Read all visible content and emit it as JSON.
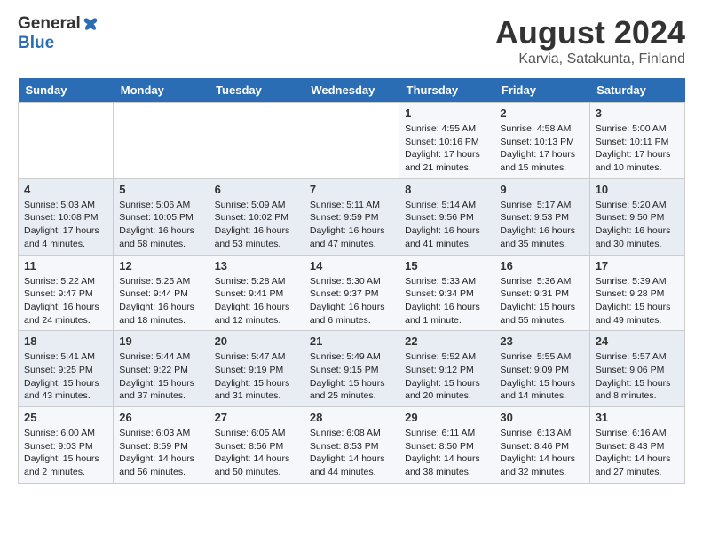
{
  "header": {
    "logo_general": "General",
    "logo_blue": "Blue",
    "month_title": "August 2024",
    "location": "Karvia, Satakunta, Finland"
  },
  "days_of_week": [
    "Sunday",
    "Monday",
    "Tuesday",
    "Wednesday",
    "Thursday",
    "Friday",
    "Saturday"
  ],
  "weeks": [
    [
      {
        "day": "",
        "content": ""
      },
      {
        "day": "",
        "content": ""
      },
      {
        "day": "",
        "content": ""
      },
      {
        "day": "",
        "content": ""
      },
      {
        "day": "1",
        "content": "Sunrise: 4:55 AM\nSunset: 10:16 PM\nDaylight: 17 hours\nand 21 minutes."
      },
      {
        "day": "2",
        "content": "Sunrise: 4:58 AM\nSunset: 10:13 PM\nDaylight: 17 hours\nand 15 minutes."
      },
      {
        "day": "3",
        "content": "Sunrise: 5:00 AM\nSunset: 10:11 PM\nDaylight: 17 hours\nand 10 minutes."
      }
    ],
    [
      {
        "day": "4",
        "content": "Sunrise: 5:03 AM\nSunset: 10:08 PM\nDaylight: 17 hours\nand 4 minutes."
      },
      {
        "day": "5",
        "content": "Sunrise: 5:06 AM\nSunset: 10:05 PM\nDaylight: 16 hours\nand 58 minutes."
      },
      {
        "day": "6",
        "content": "Sunrise: 5:09 AM\nSunset: 10:02 PM\nDaylight: 16 hours\nand 53 minutes."
      },
      {
        "day": "7",
        "content": "Sunrise: 5:11 AM\nSunset: 9:59 PM\nDaylight: 16 hours\nand 47 minutes."
      },
      {
        "day": "8",
        "content": "Sunrise: 5:14 AM\nSunset: 9:56 PM\nDaylight: 16 hours\nand 41 minutes."
      },
      {
        "day": "9",
        "content": "Sunrise: 5:17 AM\nSunset: 9:53 PM\nDaylight: 16 hours\nand 35 minutes."
      },
      {
        "day": "10",
        "content": "Sunrise: 5:20 AM\nSunset: 9:50 PM\nDaylight: 16 hours\nand 30 minutes."
      }
    ],
    [
      {
        "day": "11",
        "content": "Sunrise: 5:22 AM\nSunset: 9:47 PM\nDaylight: 16 hours\nand 24 minutes."
      },
      {
        "day": "12",
        "content": "Sunrise: 5:25 AM\nSunset: 9:44 PM\nDaylight: 16 hours\nand 18 minutes."
      },
      {
        "day": "13",
        "content": "Sunrise: 5:28 AM\nSunset: 9:41 PM\nDaylight: 16 hours\nand 12 minutes."
      },
      {
        "day": "14",
        "content": "Sunrise: 5:30 AM\nSunset: 9:37 PM\nDaylight: 16 hours\nand 6 minutes."
      },
      {
        "day": "15",
        "content": "Sunrise: 5:33 AM\nSunset: 9:34 PM\nDaylight: 16 hours\nand 1 minute."
      },
      {
        "day": "16",
        "content": "Sunrise: 5:36 AM\nSunset: 9:31 PM\nDaylight: 15 hours\nand 55 minutes."
      },
      {
        "day": "17",
        "content": "Sunrise: 5:39 AM\nSunset: 9:28 PM\nDaylight: 15 hours\nand 49 minutes."
      }
    ],
    [
      {
        "day": "18",
        "content": "Sunrise: 5:41 AM\nSunset: 9:25 PM\nDaylight: 15 hours\nand 43 minutes."
      },
      {
        "day": "19",
        "content": "Sunrise: 5:44 AM\nSunset: 9:22 PM\nDaylight: 15 hours\nand 37 minutes."
      },
      {
        "day": "20",
        "content": "Sunrise: 5:47 AM\nSunset: 9:19 PM\nDaylight: 15 hours\nand 31 minutes."
      },
      {
        "day": "21",
        "content": "Sunrise: 5:49 AM\nSunset: 9:15 PM\nDaylight: 15 hours\nand 25 minutes."
      },
      {
        "day": "22",
        "content": "Sunrise: 5:52 AM\nSunset: 9:12 PM\nDaylight: 15 hours\nand 20 minutes."
      },
      {
        "day": "23",
        "content": "Sunrise: 5:55 AM\nSunset: 9:09 PM\nDaylight: 15 hours\nand 14 minutes."
      },
      {
        "day": "24",
        "content": "Sunrise: 5:57 AM\nSunset: 9:06 PM\nDaylight: 15 hours\nand 8 minutes."
      }
    ],
    [
      {
        "day": "25",
        "content": "Sunrise: 6:00 AM\nSunset: 9:03 PM\nDaylight: 15 hours\nand 2 minutes."
      },
      {
        "day": "26",
        "content": "Sunrise: 6:03 AM\nSunset: 8:59 PM\nDaylight: 14 hours\nand 56 minutes."
      },
      {
        "day": "27",
        "content": "Sunrise: 6:05 AM\nSunset: 8:56 PM\nDaylight: 14 hours\nand 50 minutes."
      },
      {
        "day": "28",
        "content": "Sunrise: 6:08 AM\nSunset: 8:53 PM\nDaylight: 14 hours\nand 44 minutes."
      },
      {
        "day": "29",
        "content": "Sunrise: 6:11 AM\nSunset: 8:50 PM\nDaylight: 14 hours\nand 38 minutes."
      },
      {
        "day": "30",
        "content": "Sunrise: 6:13 AM\nSunset: 8:46 PM\nDaylight: 14 hours\nand 32 minutes."
      },
      {
        "day": "31",
        "content": "Sunrise: 6:16 AM\nSunset: 8:43 PM\nDaylight: 14 hours\nand 27 minutes."
      }
    ]
  ]
}
